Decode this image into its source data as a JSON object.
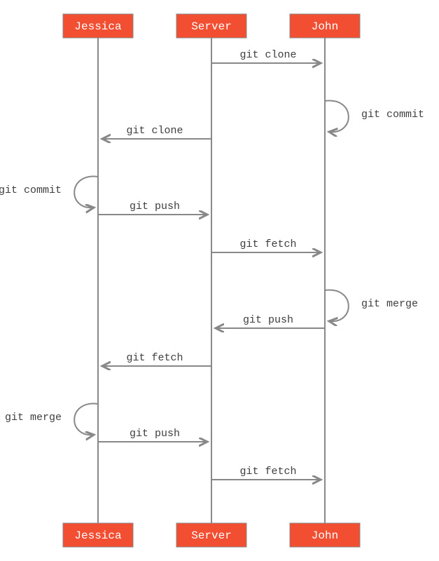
{
  "chart_data": {
    "type": "sequence-diagram",
    "actors": [
      {
        "id": "jessica",
        "label": "Jessica"
      },
      {
        "id": "server",
        "label": "Server"
      },
      {
        "id": "john",
        "label": "John"
      }
    ],
    "messages": [
      {
        "from": "server",
        "to": "john",
        "label": "git clone"
      },
      {
        "from": "john",
        "to": "john",
        "label": "git commit",
        "side": "right"
      },
      {
        "from": "server",
        "to": "jessica",
        "label": "git clone"
      },
      {
        "from": "jessica",
        "to": "jessica",
        "label": "git commit",
        "side": "left"
      },
      {
        "from": "jessica",
        "to": "server",
        "label": "git push"
      },
      {
        "from": "server",
        "to": "john",
        "label": "git fetch"
      },
      {
        "from": "john",
        "to": "john",
        "label": "git merge",
        "side": "right"
      },
      {
        "from": "john",
        "to": "server",
        "label": "git push"
      },
      {
        "from": "server",
        "to": "jessica",
        "label": "git fetch"
      },
      {
        "from": "jessica",
        "to": "jessica",
        "label": "git merge",
        "side": "left"
      },
      {
        "from": "jessica",
        "to": "server",
        "label": "git push"
      },
      {
        "from": "server",
        "to": "john",
        "label": "git fetch"
      }
    ],
    "colors": {
      "actor_fill": "#f14e32",
      "actor_text": "#ffffff",
      "line": "#888888"
    }
  }
}
